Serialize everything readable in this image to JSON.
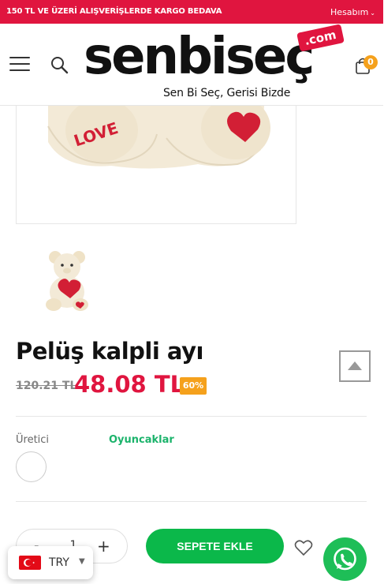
{
  "topbar": {
    "promo": "150 TL VE ÜZERİ ALIŞVERİŞLERDE KARGO BEDAVA",
    "account_label": "Hesabım"
  },
  "header": {
    "logo_wordmark": "senbiseç",
    "logo_suffix": ".com",
    "logo_tagline": "Sen Bi Seç, Gerisi Bizde",
    "cart_count": "0"
  },
  "product": {
    "image_text": "LOVE",
    "title": "Pelüş kalpli ayı",
    "old_price": "120.21 TL",
    "price": "48.08 TL",
    "discount": "60%",
    "vendor_label": "Üretici",
    "vendor_value": "Oyuncaklar",
    "quantity": "1",
    "minus": "-",
    "plus": "+",
    "add_to_cart": "SEPETE EKLE"
  },
  "currency": {
    "code": "TRY"
  },
  "colors": {
    "brand_red": "#e0153f",
    "accent_orange": "#f5a11c",
    "cta_green": "#0bb84a",
    "whatsapp_green": "#1ebe57"
  }
}
